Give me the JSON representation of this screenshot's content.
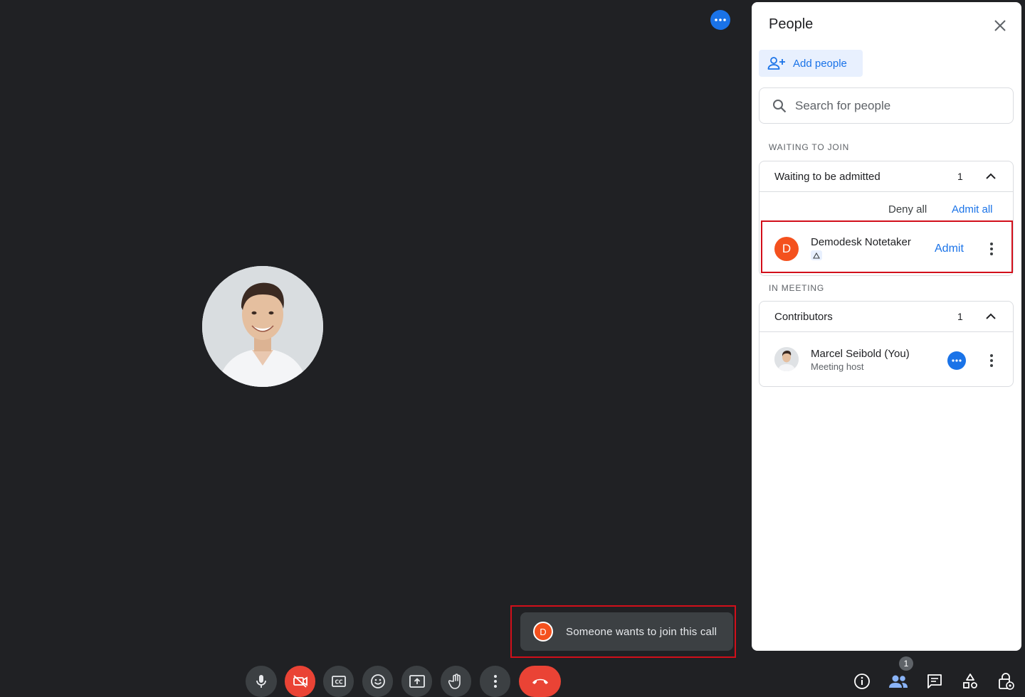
{
  "toast": {
    "avatar_letter": "D",
    "message": "Someone wants to join this call"
  },
  "panel": {
    "title": "People",
    "add_people_label": "Add people",
    "search_placeholder": "Search for people",
    "waiting_section_label": "WAITING TO JOIN",
    "waiting_group": {
      "title": "Waiting to be admitted",
      "count": "1"
    },
    "deny_all_label": "Deny all",
    "admit_all_label": "Admit all",
    "waiting_person": {
      "avatar_letter": "D",
      "name": "Demodesk Notetaker",
      "admit_label": "Admit"
    },
    "meeting_section_label": "IN MEETING",
    "contributors_group": {
      "title": "Contributors",
      "count": "1"
    },
    "member": {
      "name": "Marcel Seibold (You)",
      "role": "Meeting host"
    }
  },
  "right_bar": {
    "people_badge": "1"
  },
  "icons": [
    "more-icon",
    "microphone-icon",
    "camera-off-icon",
    "captions-icon",
    "emoji-icon",
    "present-icon",
    "raise-hand-icon",
    "more-vert-icon",
    "hang-up-icon",
    "info-icon",
    "people-icon",
    "chat-icon",
    "activities-icon",
    "host-controls-icon",
    "close-icon",
    "add-person-icon",
    "search-icon",
    "chevron-up-icon"
  ],
  "colors": {
    "accent": "#1a73e8",
    "danger": "#ea4335",
    "avatar_orange": "#f4511e",
    "highlight_frame": "#d20f1a"
  }
}
